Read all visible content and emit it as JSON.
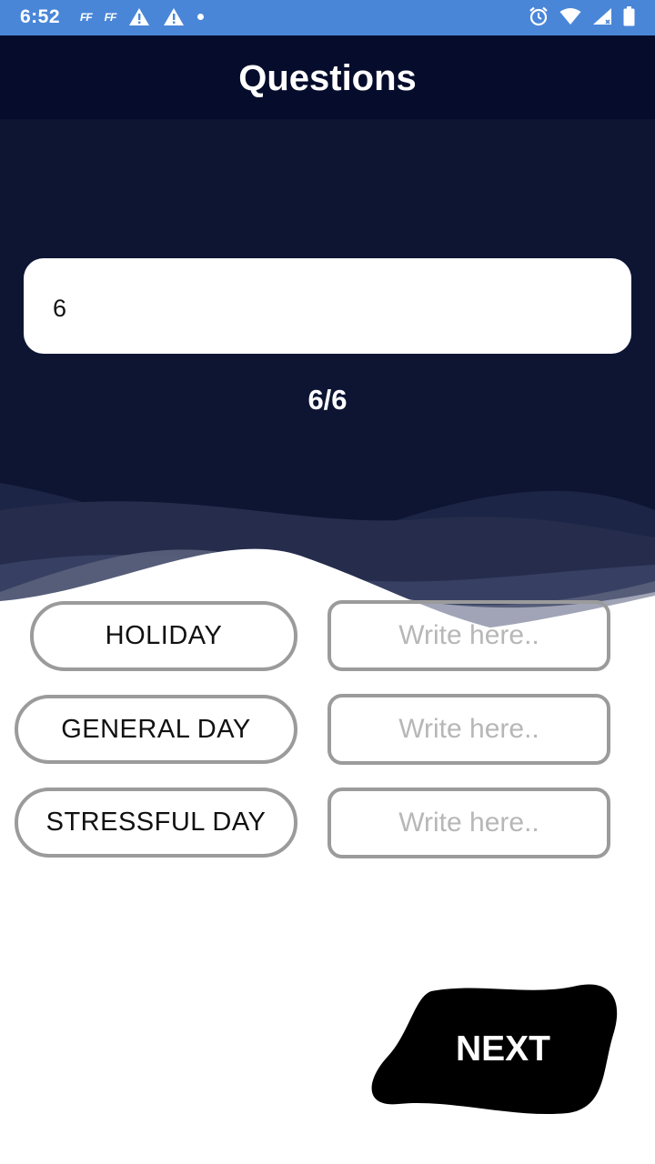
{
  "status_bar": {
    "time": "6:52",
    "left_icons": [
      "ff-icon",
      "ff-icon",
      "warning-icon",
      "warning-icon",
      "dot-icon"
    ],
    "left_icon_labels": [
      "FF",
      "FF"
    ],
    "right_icons": [
      "alarm-icon",
      "wifi-icon",
      "signal-icon",
      "battery-icon"
    ],
    "color": "#4a86d8"
  },
  "app_bar": {
    "title": "Questions",
    "color": "#060d2c"
  },
  "question": {
    "text": "6",
    "progress": "6/6"
  },
  "options": [
    {
      "label": "HOLIDAY",
      "answer_value": "",
      "answer_placeholder": "Write here.."
    },
    {
      "label": "GENERAL DAY",
      "answer_value": "",
      "answer_placeholder": "Write here.."
    },
    {
      "label": "STRESSFUL DAY",
      "answer_value": "",
      "answer_placeholder": "Write here.."
    }
  ],
  "next_button": {
    "label": "NEXT"
  },
  "colors": {
    "hero": "#0d1533",
    "border": "#9b9b9b",
    "next_blob": "#000000"
  }
}
